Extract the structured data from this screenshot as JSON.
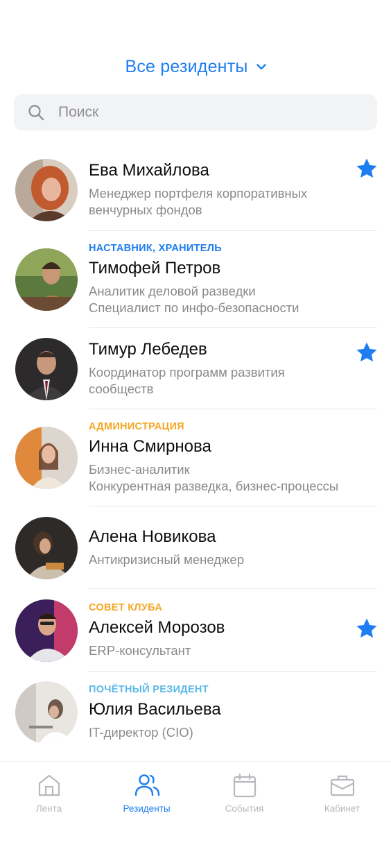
{
  "header": {
    "title": "Все резиденты"
  },
  "search": {
    "placeholder": "Поиск"
  },
  "residents": [
    {
      "name": "Ева Михайлова",
      "role": "",
      "role_color": "",
      "desc": [
        "Менеджер портфеля корпоративных",
        "венчурных фондов"
      ],
      "starred": true
    },
    {
      "name": "Тимофей Петров",
      "role": "НАСТАВНИК, ХРАНИТЕЛЬ",
      "role_color": "#1e7df0",
      "desc": [
        "Аналитик деловой разведки",
        "Специалист по инфо-безопасности"
      ],
      "starred": false
    },
    {
      "name": "Тимур Лебедев",
      "role": "",
      "role_color": "",
      "desc": [
        "Координатор программ развития",
        "сообществ"
      ],
      "starred": true
    },
    {
      "name": "Инна Смирнова",
      "role": "АДМИНИСТРАЦИЯ",
      "role_color": "#f5a623",
      "desc": [
        "Бизнес-аналитик",
        "Конкурентная разведка, бизнес-процессы"
      ],
      "starred": false
    },
    {
      "name": "Алена Новикова",
      "role": "",
      "role_color": "",
      "desc": [
        "Антикризисный менеджер"
      ],
      "starred": false
    },
    {
      "name": "Алексей Морозов",
      "role": "СОВЕТ КЛУБА",
      "role_color": "#f5a623",
      "desc": [
        "ERP-консультант"
      ],
      "starred": true
    },
    {
      "name": "Юлия Васильева",
      "role": "ПОЧЁТНЫЙ РЕЗИДЕНТ",
      "role_color": "#5ab8e8",
      "desc": [
        "IT-директор (CIO)"
      ],
      "starred": false
    }
  ],
  "tabbar": {
    "tabs": [
      {
        "label": "Лента",
        "icon": "home-icon",
        "active": false
      },
      {
        "label": "Резиденты",
        "icon": "people-icon",
        "active": true
      },
      {
        "label": "События",
        "icon": "calendar-icon",
        "active": false
      },
      {
        "label": "Кабинет",
        "icon": "briefcase-icon",
        "active": false
      }
    ]
  },
  "colors": {
    "accent": "#1e7df0",
    "inactive": "#b7b8bd",
    "admin": "#f5a623",
    "honorary": "#5ab8e8"
  }
}
